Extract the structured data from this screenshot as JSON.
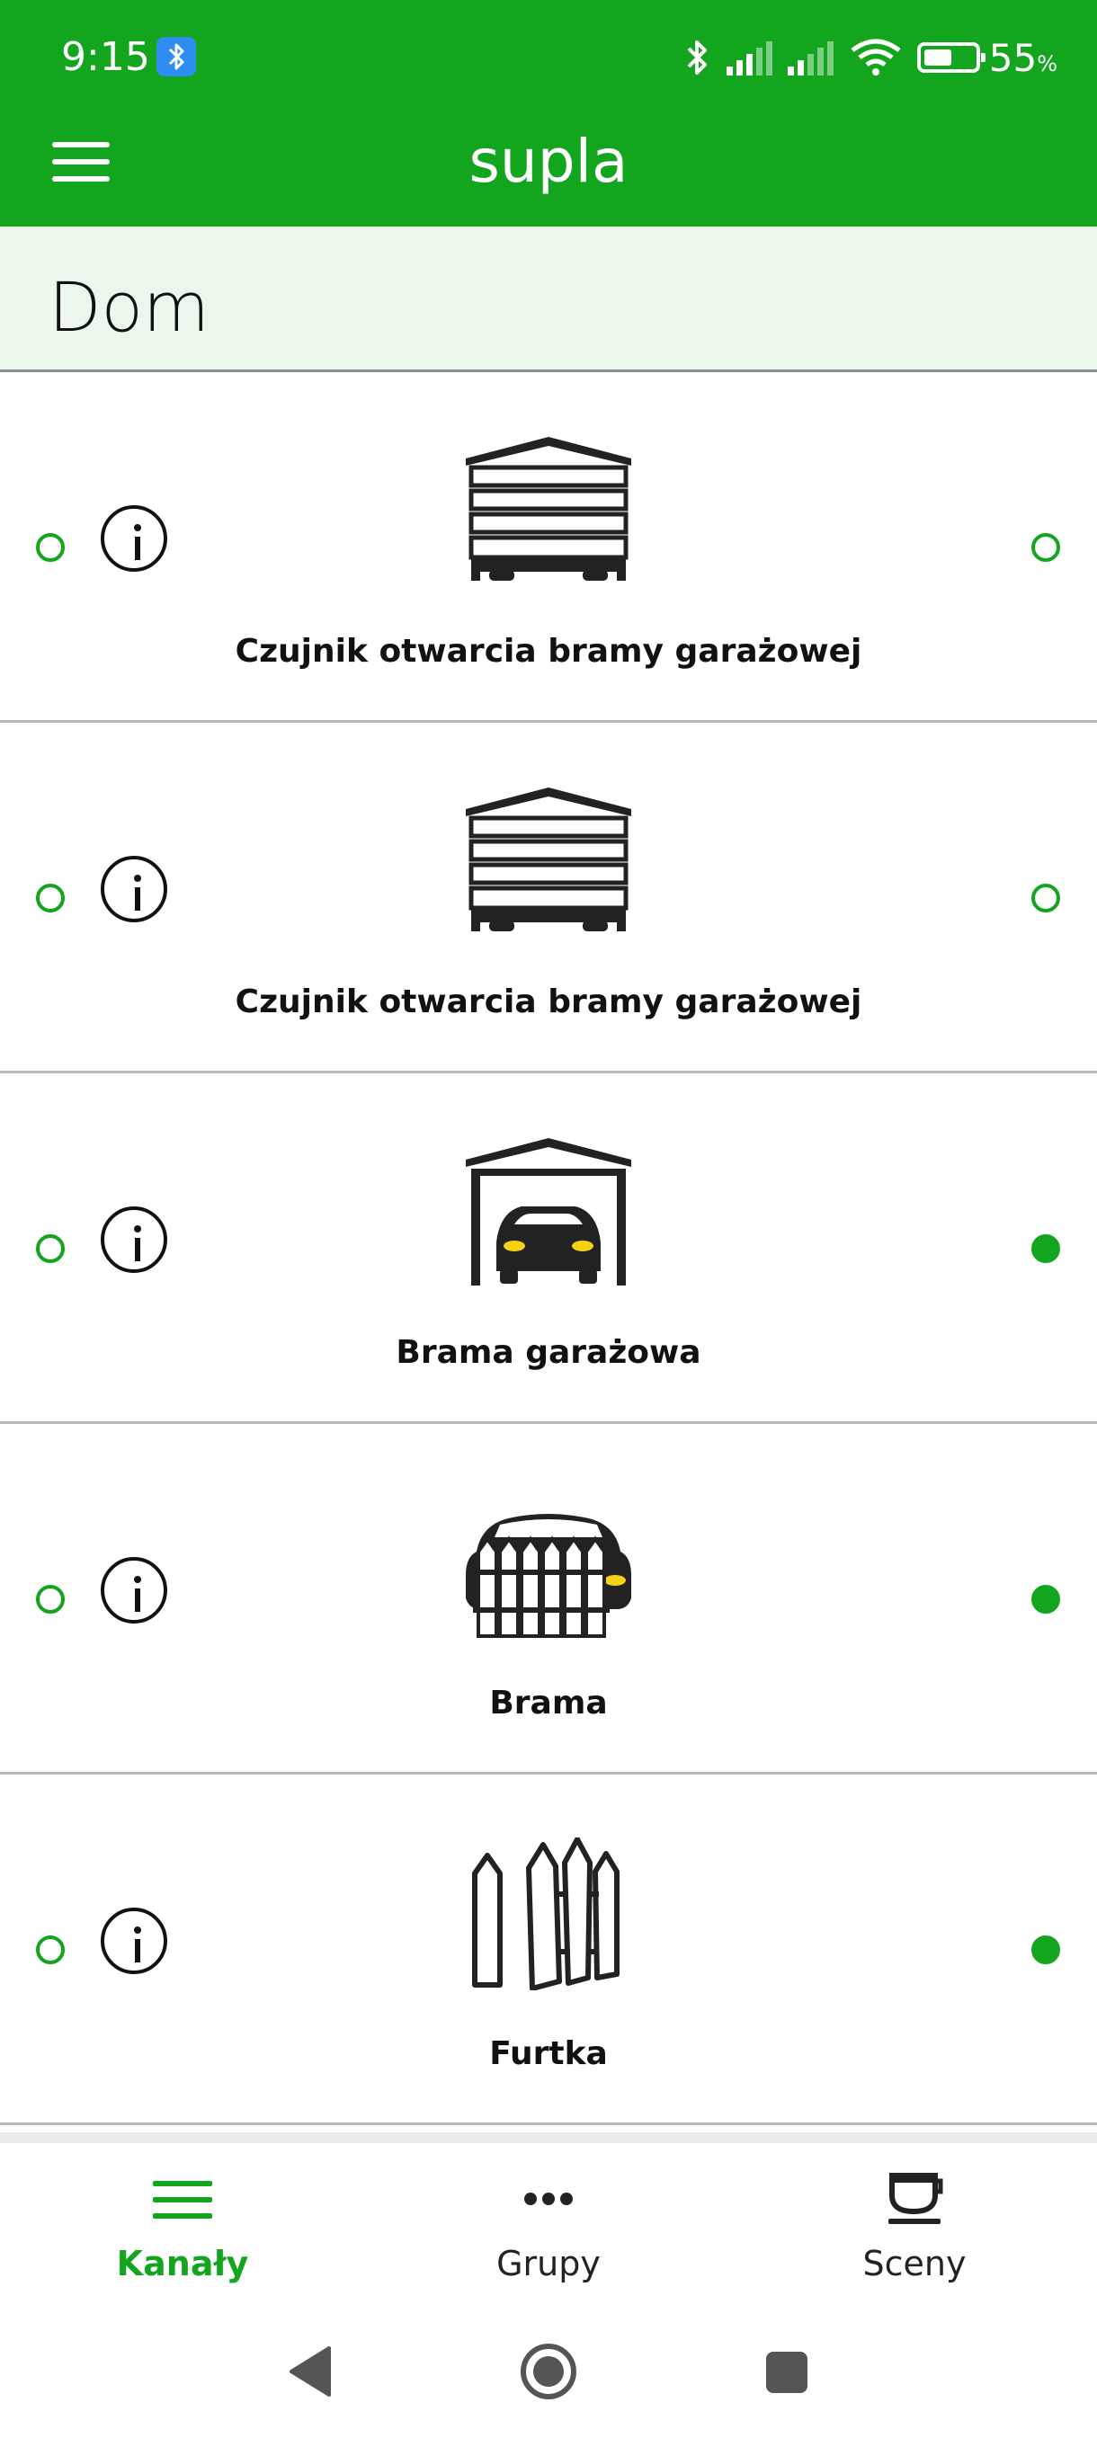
{
  "status_bar": {
    "time": "9:15",
    "battery_percent": "55",
    "battery_unit": "%",
    "battery_level": 0.55
  },
  "app": {
    "title": "supla"
  },
  "location": {
    "name": "Dom"
  },
  "channels": [
    {
      "caption": "Czujnik otwarcia bramy garażowej",
      "icon": "garage-door-closed-icon",
      "online": false
    },
    {
      "caption": "Czujnik otwarcia bramy garażowej",
      "icon": "garage-door-closed-icon",
      "online": false
    },
    {
      "caption": "Brama garażowa",
      "icon": "garage-with-car-icon",
      "online": true
    },
    {
      "caption": "Brama",
      "icon": "gate-with-car-icon",
      "online": true
    },
    {
      "caption": "Furtka",
      "icon": "wicket-gate-icon",
      "online": true
    }
  ],
  "bottom_nav": {
    "items": [
      {
        "label": "Kanały",
        "icon": "list-icon",
        "active": true
      },
      {
        "label": "Grupy",
        "icon": "dots-icon",
        "active": false
      },
      {
        "label": "Sceny",
        "icon": "cup-icon",
        "active": false
      }
    ]
  },
  "colors": {
    "primary": "#14a51f",
    "header_bg": "#eaf7ea",
    "text": "#111111"
  }
}
